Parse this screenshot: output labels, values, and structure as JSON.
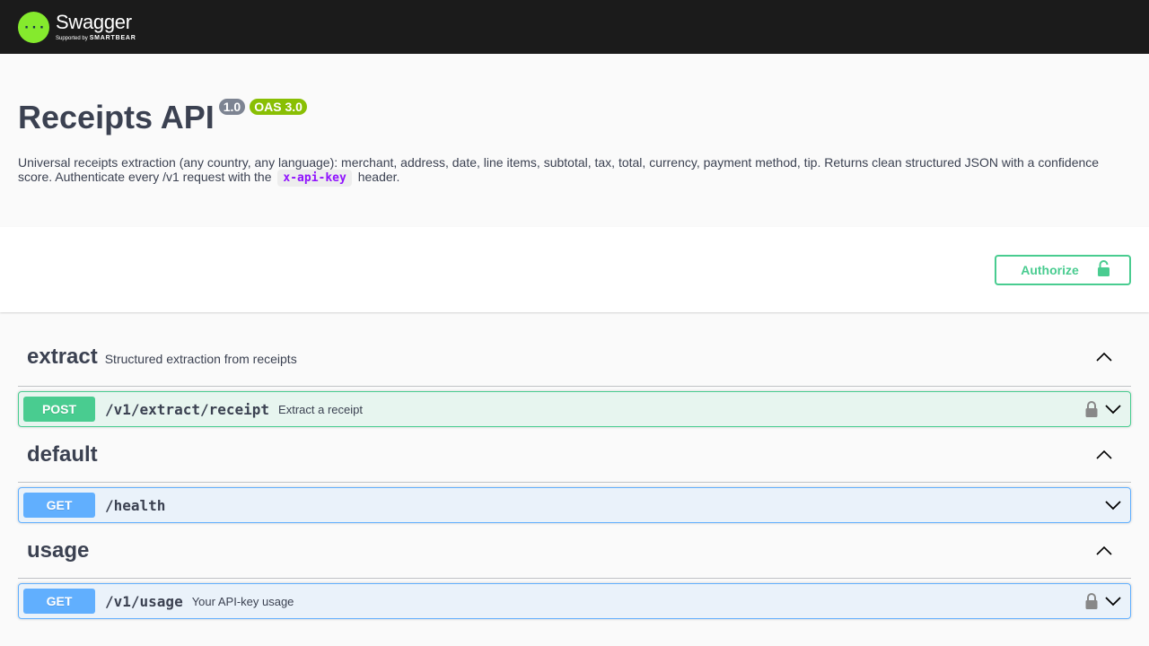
{
  "topbar": {
    "logo_name": "Swagger",
    "logo_sub_prefix": "Supported by",
    "logo_sub_brand": "SMARTBEAR",
    "logo_color": "#85ea2d"
  },
  "info": {
    "title": "Receipts API",
    "version": "1.0",
    "oas": "OAS 3.0",
    "description_before": "Universal receipts extraction (any country, any language): merchant, address, date, line items, subtotal, tax, total, currency, payment method, tip. Returns clean structured JSON with a confidence score. Authenticate every /v1 request with the",
    "description_code": "x-api-key",
    "description_after": "header."
  },
  "auth": {
    "authorize_label": "Authorize"
  },
  "tags": [
    {
      "name": "extract",
      "description": "Structured extraction from receipts",
      "operations": [
        {
          "method": "POST",
          "path": "/v1/extract/receipt",
          "summary": "Extract a receipt",
          "locked": true
        }
      ]
    },
    {
      "name": "default",
      "description": "",
      "operations": [
        {
          "method": "GET",
          "path": "/health",
          "summary": "",
          "locked": false
        }
      ]
    },
    {
      "name": "usage",
      "description": "",
      "operations": [
        {
          "method": "GET",
          "path": "/v1/usage",
          "summary": "Your API-key usage",
          "locked": true
        }
      ]
    }
  ],
  "colors": {
    "post": "#49cc90",
    "get": "#61affe",
    "version_badge": "#7d8492",
    "oas_badge": "#89bf04",
    "code": "#9012fe"
  }
}
